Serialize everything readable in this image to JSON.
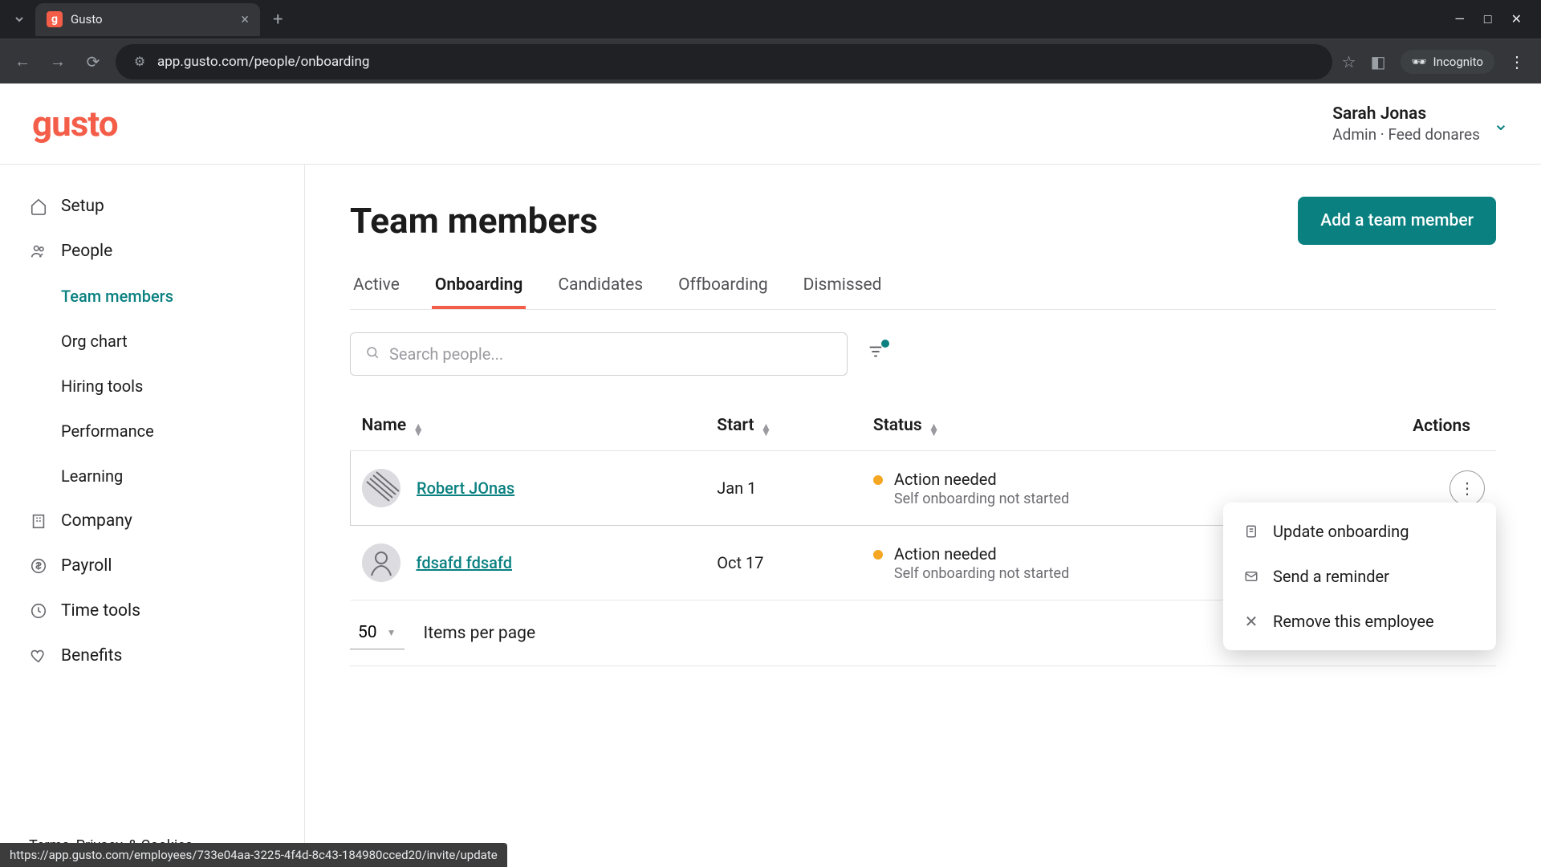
{
  "browser": {
    "tab_title": "Gusto",
    "url": "app.gusto.com/people/onboarding",
    "incognito_label": "Incognito"
  },
  "header": {
    "logo": "gusto",
    "user_name": "Sarah Jonas",
    "user_role": "Admin · Feed donares"
  },
  "sidebar": {
    "items": [
      {
        "label": "Setup",
        "icon": "home"
      },
      {
        "label": "People",
        "icon": "people"
      },
      {
        "label": "Team members",
        "sub": true,
        "active": true
      },
      {
        "label": "Org chart",
        "sub": true
      },
      {
        "label": "Hiring tools",
        "sub": true
      },
      {
        "label": "Performance",
        "sub": true
      },
      {
        "label": "Learning",
        "sub": true
      },
      {
        "label": "Company",
        "icon": "building"
      },
      {
        "label": "Payroll",
        "icon": "dollar"
      },
      {
        "label": "Time tools",
        "icon": "clock"
      },
      {
        "label": "Benefits",
        "icon": "heart"
      }
    ],
    "footer": {
      "terms": "Terms",
      "privacy": "Privacy",
      "cookies": "Cookies",
      "amp": ", & "
    }
  },
  "main": {
    "title": "Team members",
    "add_button": "Add a team member",
    "tabs": [
      "Active",
      "Onboarding",
      "Candidates",
      "Offboarding",
      "Dismissed"
    ],
    "active_tab": "Onboarding",
    "search_placeholder": "Search people...",
    "columns": {
      "name": "Name",
      "start": "Start",
      "status": "Status",
      "actions": "Actions"
    },
    "rows": [
      {
        "name": "Robert JOnas",
        "start": "Jan 1",
        "status": "Action needed",
        "status_sub": "Self onboarding not started"
      },
      {
        "name": "fdsafd fdsafd",
        "start": "Oct 17",
        "status": "Action needed",
        "status_sub": "Self onboarding not started"
      }
    ],
    "dropdown": {
      "update": "Update onboarding",
      "reminder": "Send a reminder",
      "remove": "Remove this employee"
    },
    "pagination": {
      "size": "50",
      "label": "Items per page"
    }
  },
  "hover_url": "https://app.gusto.com/employees/733e04aa-3225-4f4d-8c43-184980cced20/invite/update"
}
